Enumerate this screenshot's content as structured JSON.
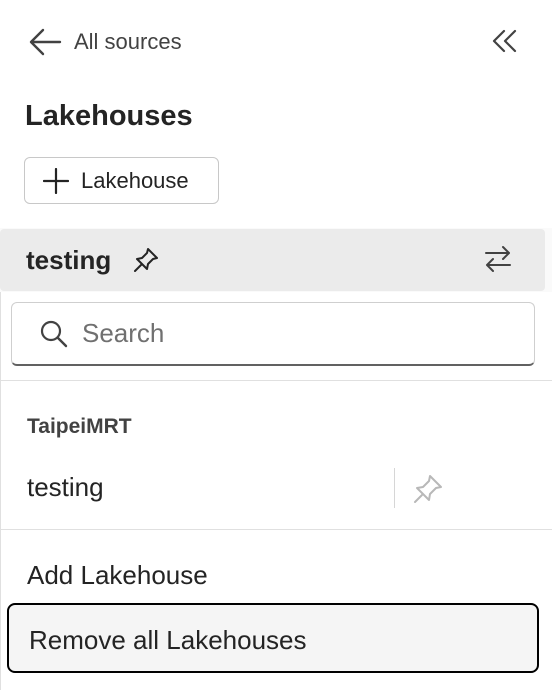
{
  "header": {
    "back_label": "All sources",
    "title": "Lakehouses",
    "add_button_label": "Lakehouse"
  },
  "selected": {
    "name": "testing",
    "pinned": true
  },
  "dropdown": {
    "search_placeholder": "Search",
    "group_label": "TaipeiMRT",
    "items": [
      {
        "name": "testing",
        "pinned": false
      }
    ],
    "actions": {
      "add": "Add Lakehouse",
      "remove_all": "Remove all Lakehouses"
    }
  },
  "icons": {
    "back": "arrow-left-icon",
    "collapse": "double-chevron-left-icon",
    "add": "plus-icon",
    "pin": "pin-icon",
    "swap": "swap-arrows-icon",
    "search": "search-icon"
  },
  "colors": {
    "selected_background": "#ebebeb",
    "focus_border": "#000000",
    "text": "#242424"
  }
}
